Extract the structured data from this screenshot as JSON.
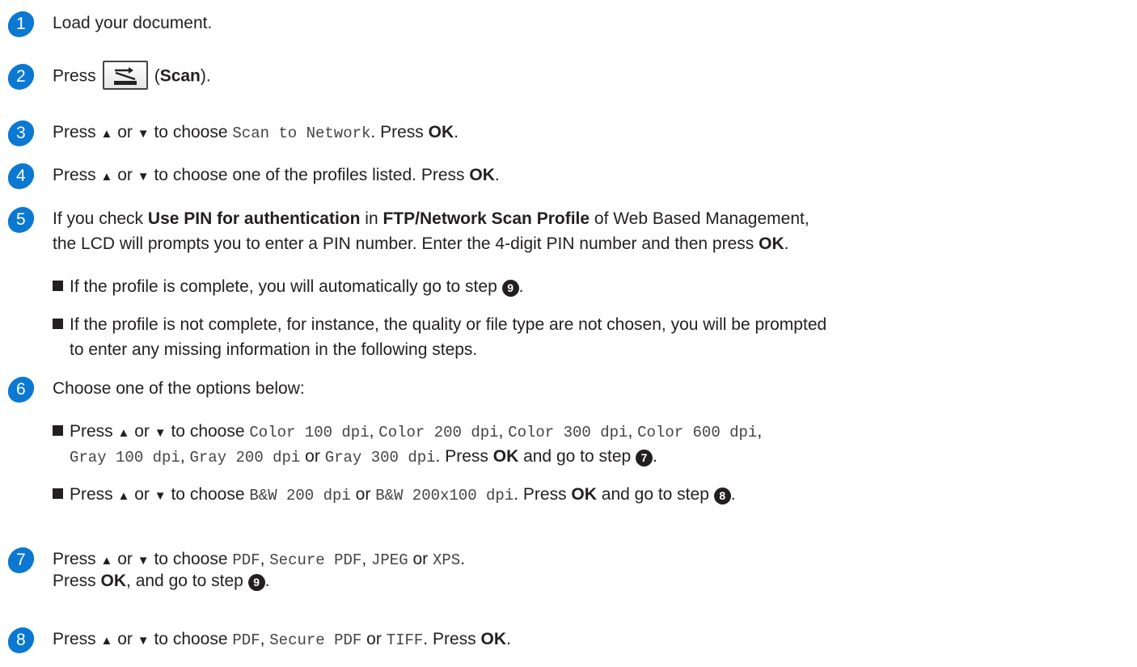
{
  "steps": [
    {
      "num": "1",
      "text": "Load your document."
    },
    {
      "num": "2",
      "press": "Press",
      "label": "Scan"
    },
    {
      "num": "3",
      "pre": "Press",
      "up": "▲",
      "or": "or",
      "down": "▼",
      "mid": "to choose",
      "mono": "Scan to Network",
      "dot": ".",
      "press": "Press",
      "ok": "OK",
      "end": "."
    },
    {
      "num": "4",
      "pre": "Press",
      "up": "▲",
      "or": "or",
      "down": "▼",
      "mid": "to choose one of the profiles listed. Press",
      "ok": "OK",
      "end": "."
    },
    {
      "num": "5",
      "line1_pre": "If you check",
      "b1": "Use PIN for authentication",
      "in": "in",
      "b2": "FTP/Network Scan Profile",
      "line1_post": "of Web Based Management,",
      "line2_pre": "the LCD will prompts you to enter a PIN number. Enter the 4-digit PIN number and then press",
      "ok": "OK",
      "end": ".",
      "bullet1": "If the profile is complete, you will automatically go to step",
      "bullet1_ref": "9",
      "bullet2_l1": "If the profile is not complete, for instance, the quality or file type are not chosen, you will be prompted",
      "bullet2_l2": "to enter any missing information in the following steps."
    },
    {
      "num": "6",
      "text": "Choose one of the options below:",
      "b1_pre": "Press",
      "b1_mid": "to choose",
      "b1_opts": [
        "Color 100 dpi",
        "Color 200 dpi",
        "Color 300 dpi",
        "Color 600 dpi"
      ],
      "b1_opts2": [
        "Gray 100 dpi",
        "Gray 200 dpi",
        "Gray 300 dpi"
      ],
      "b1_post": "Press",
      "ok": "OK",
      "b1_go": "and go to step",
      "b1_ref": "7",
      "b2_opts": [
        "B&W 200 dpi",
        "B&W 200x100 dpi"
      ],
      "b2_ref": "8"
    },
    {
      "num": "7",
      "opts": [
        "PDF",
        "Secure PDF",
        "JPEG",
        "XPS"
      ],
      "l2_pre": "Press",
      "l2_post": ", and go to step",
      "ref": "9"
    },
    {
      "num": "8",
      "opts": [
        "PDF",
        "Secure PDF",
        "TIFF"
      ],
      "ok": "OK"
    }
  ],
  "common": {
    "press": "Press",
    "or": "or",
    "to_choose": "to choose",
    "up": "▲",
    "down": "▼",
    "ok": "OK",
    "comma": ",",
    "period": "."
  }
}
